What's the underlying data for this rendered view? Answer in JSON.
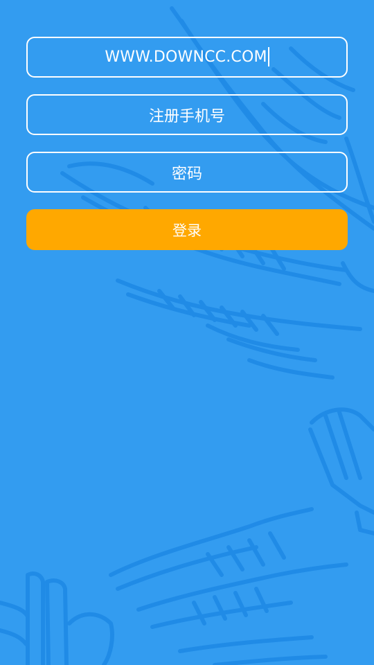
{
  "theme": {
    "background": "#339cf0",
    "decoration": "#1f8ae6",
    "accent": "#ffa800",
    "text": "#ffffff"
  },
  "form": {
    "url_field_value": "WWW.DOWNCC.COM",
    "phone_placeholder": "注册手机号",
    "password_placeholder": "密码",
    "login_label": "登录"
  },
  "background_art": "wing-illustration"
}
